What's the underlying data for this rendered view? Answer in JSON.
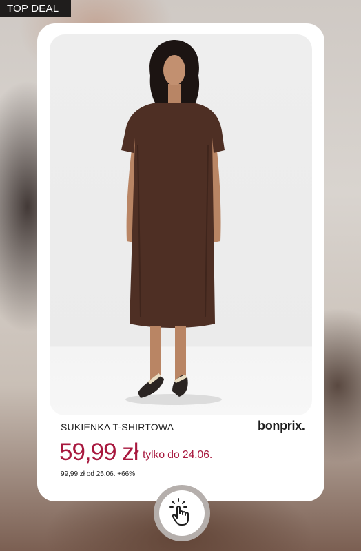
{
  "badge": {
    "label": "TOP DEAL"
  },
  "product": {
    "name": "SUKIENKA T-SHIRTOWA",
    "brand": "bonprix.",
    "price": "59,99 zł",
    "offer_note": "tylko do 24.06.",
    "old_price_note": "99,99 zł od 25.06. +66%"
  },
  "colors": {
    "price": "#a8183e",
    "badge_bg": "#1f1d1c",
    "dress": "#4e2f24"
  },
  "icons": {
    "tap": "hand-tap-icon"
  }
}
